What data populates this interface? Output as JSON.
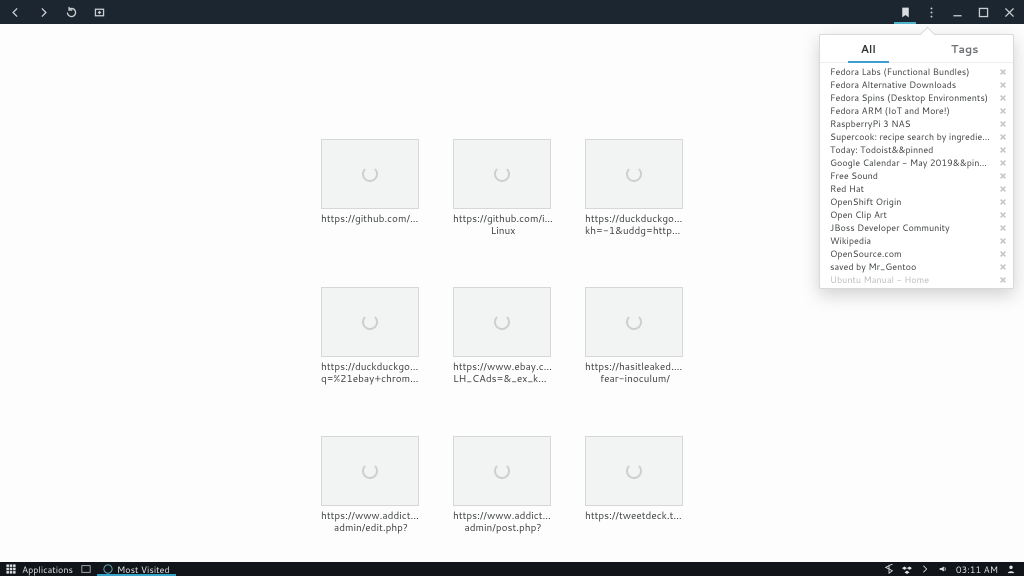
{
  "header": {
    "icons": [
      "back",
      "forward",
      "reload",
      "newtab"
    ],
    "right_icons": [
      "bookmark",
      "menu",
      "minimize",
      "maximize",
      "close"
    ]
  },
  "bookmarks_panel": {
    "tabs": [
      {
        "label": "All",
        "active": true
      },
      {
        "label": "Tags",
        "active": false
      }
    ],
    "items": [
      {
        "label": "Fedora Labs (Functional Bundles)"
      },
      {
        "label": "Fedora Alternative Downloads"
      },
      {
        "label": "Fedora Spins (Desktop Environments)"
      },
      {
        "label": "Fedora ARM (IoT and More!)"
      },
      {
        "label": "RaspberryPi 3 NAS"
      },
      {
        "label": "Supercook: recipe search by ingredients ..."
      },
      {
        "label": "Today: Todoist&&pinned"
      },
      {
        "label": "Google Calendar - May 2019&&pinned"
      },
      {
        "label": "Free Sound"
      },
      {
        "label": "Red Hat"
      },
      {
        "label": "OpenShift Origin"
      },
      {
        "label": "Open Clip Art"
      },
      {
        "label": "JBoss Developer Community"
      },
      {
        "label": "Wikipedia"
      },
      {
        "label": "OpenSource.com"
      },
      {
        "label": "saved by Mr_Gentoo"
      },
      {
        "label": "Ubuntu Manual - Home",
        "faded": true
      }
    ]
  },
  "speed_dial": [
    {
      "line1": "https://github.com/g...",
      "line2": ""
    },
    {
      "line1": "https://github.com/iln...",
      "line2": "Linux"
    },
    {
      "line1": "https://duckduckgo.c...",
      "line2": "kh=-1&uddg=https..."
    },
    {
      "line1": "https://duckduckgo.c...",
      "line2": "q=%21ebay+chrome..."
    },
    {
      "line1": "https://www.ebay.co...",
      "line2": "LH_CAds=&_ex_kw=..."
    },
    {
      "line1": "https://hasitleaked.co...",
      "line2": "fear-inoculum/"
    },
    {
      "line1": "https://www.addictive...",
      "line2": "admin/edit.php?"
    },
    {
      "line1": "https://www.addictive...",
      "line2": "admin/post.php?"
    },
    {
      "line1": "https://tweetdeck.twi...",
      "line2": ""
    }
  ],
  "panel": {
    "applications_label": "Applications",
    "task_label": "Most Visited",
    "clock": "03:11 AM"
  }
}
